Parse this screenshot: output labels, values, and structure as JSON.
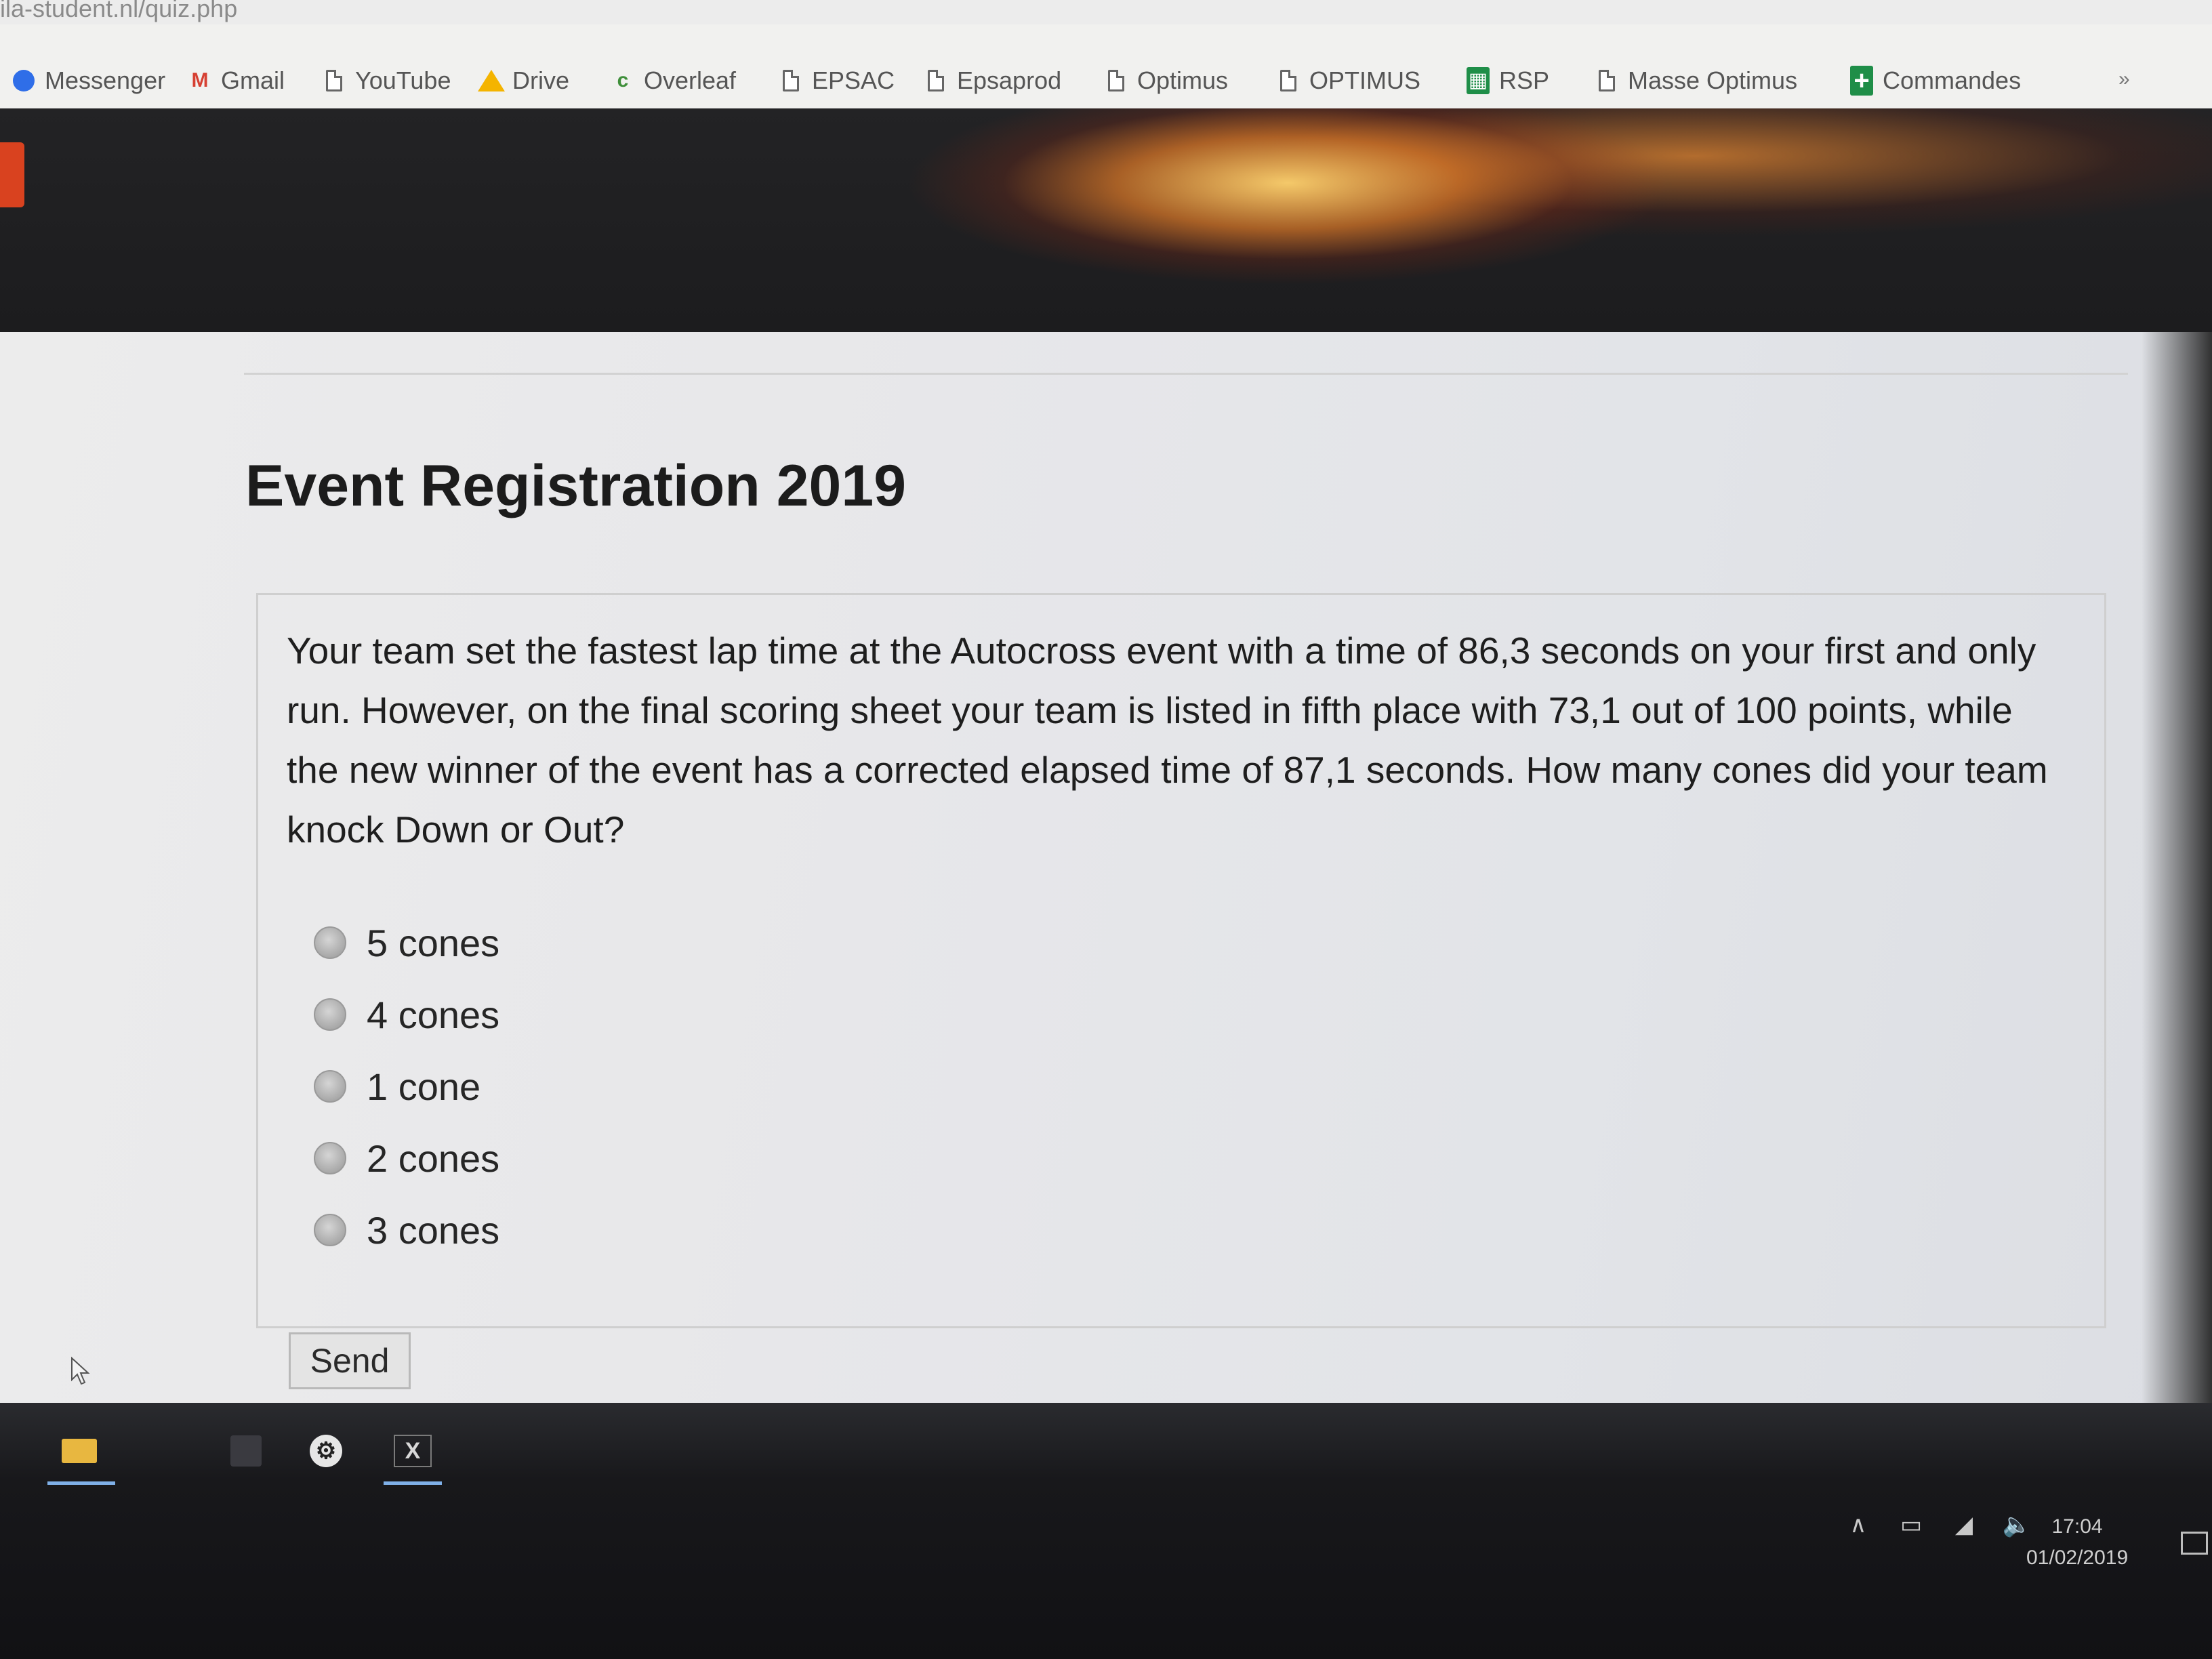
{
  "browser": {
    "url": "ila-student.nl/quiz.php",
    "bookmarks": [
      {
        "label": "Messenger",
        "icon": "messenger-icon"
      },
      {
        "label": "Gmail",
        "icon": "gmail-icon"
      },
      {
        "label": "YouTube",
        "icon": "page-icon"
      },
      {
        "label": "Drive",
        "icon": "drive-icon"
      },
      {
        "label": "Overleaf",
        "icon": "overleaf-icon"
      },
      {
        "label": "EPSAC",
        "icon": "page-icon"
      },
      {
        "label": "Epsaprod",
        "icon": "page-icon"
      },
      {
        "label": "Optimus",
        "icon": "page-icon"
      },
      {
        "label": "OPTIMUS",
        "icon": "page-icon"
      },
      {
        "label": "RSP",
        "icon": "sheets-icon"
      },
      {
        "label": "Masse Optimus",
        "icon": "page-icon"
      },
      {
        "label": "Commandes",
        "icon": "plus-icon"
      }
    ],
    "more_bookmarks": "»"
  },
  "page": {
    "title": "Event Registration 2019",
    "question": "Your team set the fastest lap time at the Autocross event with a time of 86,3 seconds on your first and only run. However, on the final scoring sheet your team is listed in fifth place with 73,1 out of 100 points, while the new winner of the event has a corrected elapsed time of 87,1 seconds. How many cones did your team knock Down or Out?",
    "options": [
      "5 cones",
      "4 cones",
      "1 cone",
      "2 cones",
      "3 cones"
    ],
    "send_label": "Send"
  },
  "taskbar": {
    "apps": [
      "file-explorer-icon",
      "store-icon",
      "settings-icon",
      "excel-icon"
    ],
    "time": "17:04",
    "date": "01/02/2019"
  }
}
